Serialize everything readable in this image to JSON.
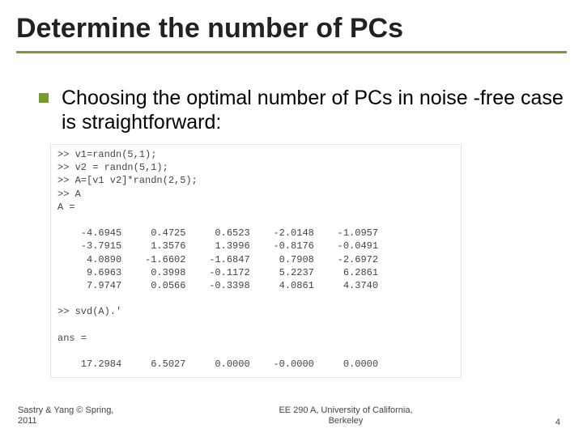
{
  "title": "Determine the number of PCs",
  "bullet": "Choosing the optimal number of PCs in noise -free case is straightforward:",
  "code": {
    "lines": [
      ">> v1=randn(5,1);",
      ">> v2 = randn(5,1);",
      ">> A=[v1 v2]*randn(2,5);",
      ">> A",
      "",
      "A ="
    ],
    "matrix": [
      "    -4.6945     0.4725     0.6523    -2.0148    -1.0957",
      "    -3.7915     1.3576     1.3996    -0.8176    -0.0491",
      "     4.0890    -1.6602    -1.6847     0.7908    -2.6972",
      "     9.6963     0.3998    -0.1172     5.2237     6.2861",
      "     7.9747     0.0566    -0.3398     4.0861     4.3740"
    ],
    "svd_call": ">> svd(A).'",
    "ans_label": "ans =",
    "svd_row": "    17.2984     6.5027     0.0000    -0.0000     0.0000"
  },
  "footer": {
    "left_line1": "Sastry & Yang © Spring,",
    "left_line2": "2011",
    "center_line1": "EE 290 A, University of California,",
    "center_line2": "Berkeley",
    "pagenum": "4"
  }
}
